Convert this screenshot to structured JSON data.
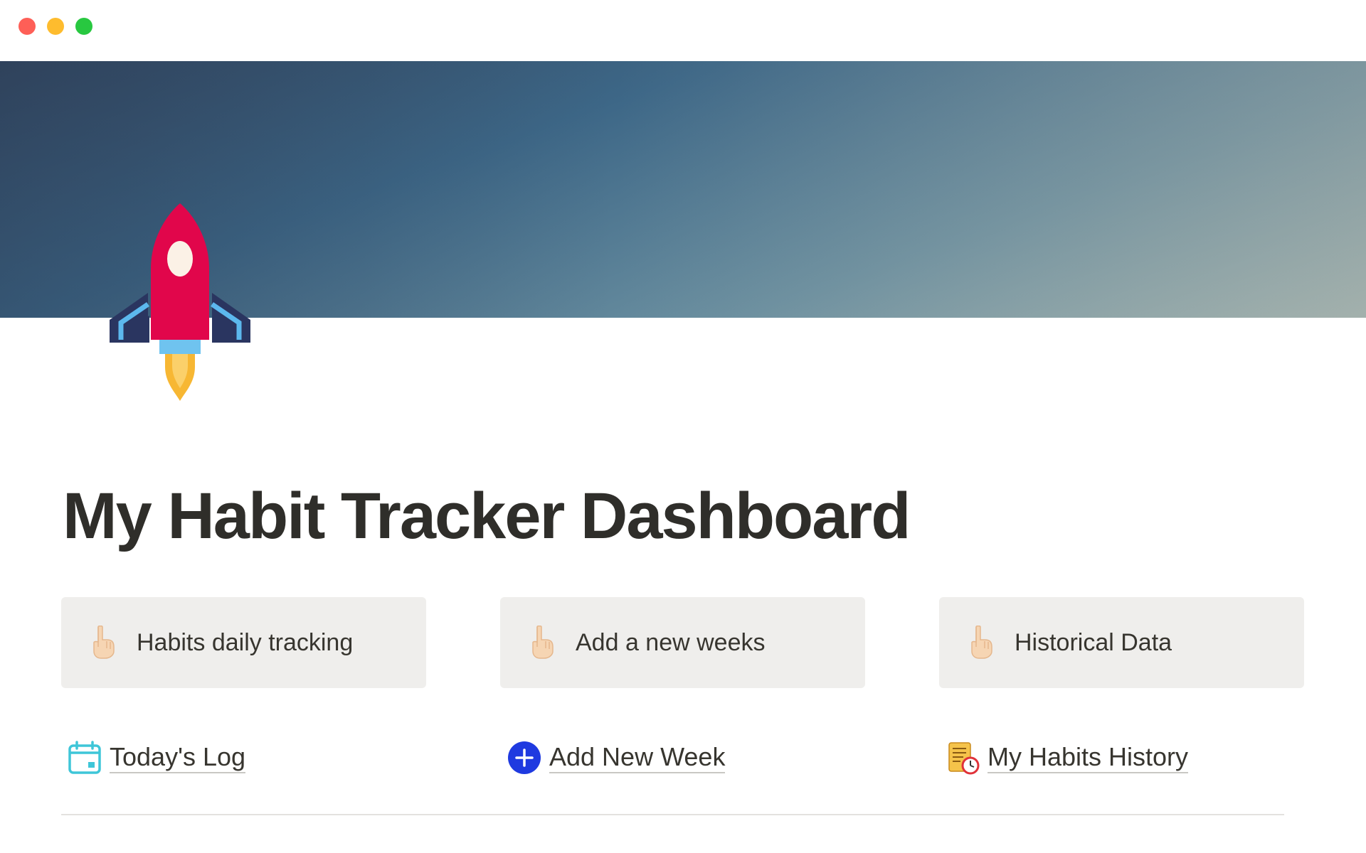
{
  "page": {
    "title": "My Habit Tracker Dashboard",
    "icon": "rocket-icon",
    "cover_colors": [
      "#334862",
      "#3d6787",
      "#6a8fa0",
      "#9fb4b3"
    ]
  },
  "callouts": [
    {
      "icon": "pointing-down-hand-icon",
      "label": "Habits daily tracking"
    },
    {
      "icon": "pointing-down-hand-icon",
      "label": "Add a new weeks"
    },
    {
      "icon": "pointing-down-hand-icon",
      "label": "Historical Data"
    }
  ],
  "links": [
    {
      "icon": "calendar-icon",
      "label": "Today's Log"
    },
    {
      "icon": "plus-circle-icon",
      "label": "Add New Week"
    },
    {
      "icon": "scroll-clock-icon",
      "label": "My Habits History"
    }
  ],
  "colors": {
    "callout_bg": "#efeeec",
    "text": "#37352f",
    "plus_blue": "#1f3ae0",
    "calendar_teal": "#3ec6d8"
  }
}
